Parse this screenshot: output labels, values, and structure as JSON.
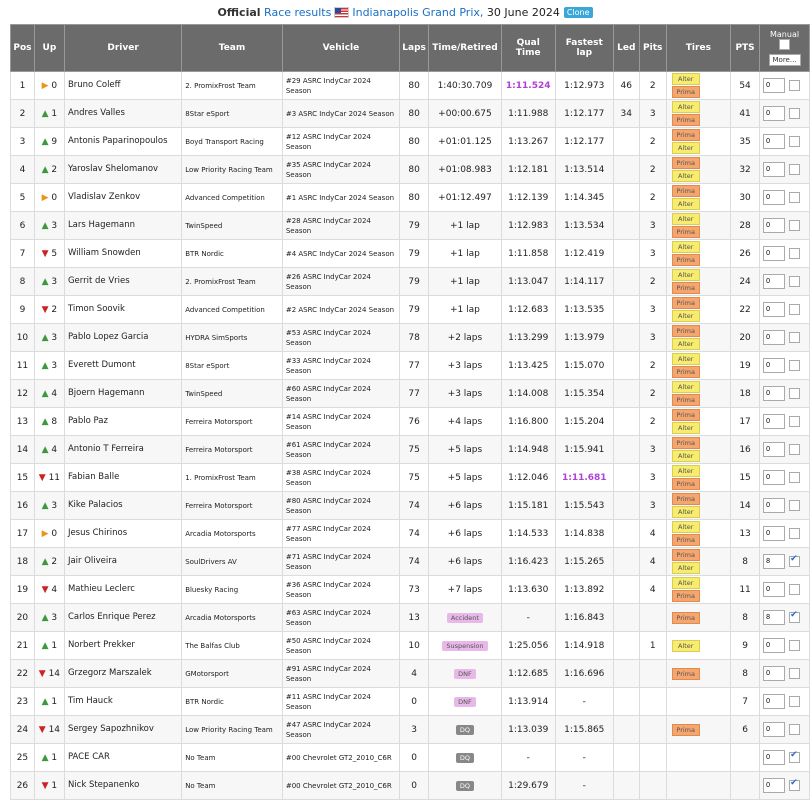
{
  "header": {
    "prefix": "Official",
    "link": "Race results",
    "event": "Indianapolis Grand Prix,",
    "date": "30 June 2024",
    "clone_label": "Clone"
  },
  "columns": [
    "Pos",
    "Up",
    "Driver",
    "Team",
    "Vehicle",
    "Laps",
    "Time/Retired",
    "Qual Time",
    "Fastest lap",
    "Led",
    "Pits",
    "Tires",
    "PTS"
  ],
  "manual": {
    "label": "Manual",
    "more_label": "More..."
  },
  "rows": [
    {
      "pos": "1",
      "up": "0",
      "dir": "same",
      "driver": "Bruno Coleff",
      "team": "2. PromixFrost Team",
      "vehicle": "#29 ASRC IndyCar 2024 Season",
      "laps": "80",
      "time": "1:40:30.709",
      "qual": "1:11.524",
      "qual_best": true,
      "fast": "1:12.973",
      "fast_best": false,
      "led": "46",
      "pits": "2",
      "tires": [
        "Alter",
        "Prima"
      ],
      "pts": "54",
      "manual": "0",
      "checked": false
    },
    {
      "pos": "2",
      "up": "1",
      "dir": "up",
      "driver": "Andres Valles",
      "team": "8Star eSport",
      "vehicle": "#3 ASRC IndyCar 2024 Season",
      "laps": "80",
      "time": "+00:00.675",
      "qual": "1:11.988",
      "qual_best": false,
      "fast": "1:12.177",
      "fast_best": false,
      "led": "34",
      "pits": "3",
      "tires": [
        "Alter",
        "Prima"
      ],
      "pts": "41",
      "manual": "0",
      "checked": false
    },
    {
      "pos": "3",
      "up": "9",
      "dir": "up",
      "driver": "Antonis Paparinopoulos",
      "team": "Boyd Transport Racing",
      "vehicle": "#12 ASRC IndyCar 2024 Season",
      "laps": "80",
      "time": "+01:01.125",
      "qual": "1:13.267",
      "qual_best": false,
      "fast": "1:12.177",
      "fast_best": false,
      "led": "",
      "pits": "2",
      "tires": [
        "Prima",
        "Alter"
      ],
      "pts": "35",
      "manual": "0",
      "checked": false
    },
    {
      "pos": "4",
      "up": "2",
      "dir": "up",
      "driver": "Yaroslav Shelomanov",
      "team": "Low Priority Racing Team",
      "vehicle": "#35 ASRC IndyCar 2024 Season",
      "laps": "80",
      "time": "+01:08.983",
      "qual": "1:12.181",
      "qual_best": false,
      "fast": "1:13.514",
      "fast_best": false,
      "led": "",
      "pits": "2",
      "tires": [
        "Prima",
        "Alter"
      ],
      "pts": "32",
      "manual": "0",
      "checked": false
    },
    {
      "pos": "5",
      "up": "0",
      "dir": "same",
      "driver": "Vladislav Zenkov",
      "team": "Advanced Competition",
      "vehicle": "#1 ASRC IndyCar 2024 Season",
      "laps": "80",
      "time": "+01:12.497",
      "qual": "1:12.139",
      "qual_best": false,
      "fast": "1:14.345",
      "fast_best": false,
      "led": "",
      "pits": "2",
      "tires": [
        "Prima",
        "Alter"
      ],
      "pts": "30",
      "manual": "0",
      "checked": false
    },
    {
      "pos": "6",
      "up": "3",
      "dir": "up",
      "driver": "Lars Hagemann",
      "team": "TwinSpeed",
      "vehicle": "#28 ASRC IndyCar 2024 Season",
      "laps": "79",
      "time": "+1 lap",
      "qual": "1:12.983",
      "qual_best": false,
      "fast": "1:13.534",
      "fast_best": false,
      "led": "",
      "pits": "3",
      "tires": [
        "Alter",
        "Prima"
      ],
      "pts": "28",
      "manual": "0",
      "checked": false
    },
    {
      "pos": "7",
      "up": "5",
      "dir": "down",
      "driver": "William Snowden",
      "team": "BTR Nordic",
      "vehicle": "#4 ASRC IndyCar 2024 Season",
      "laps": "79",
      "time": "+1 lap",
      "qual": "1:11.858",
      "qual_best": false,
      "fast": "1:12.419",
      "fast_best": false,
      "led": "",
      "pits": "3",
      "tires": [
        "Alter",
        "Prima"
      ],
      "pts": "26",
      "manual": "0",
      "checked": false
    },
    {
      "pos": "8",
      "up": "3",
      "dir": "up",
      "driver": "Gerrit de Vries",
      "team": "2. PromixFrost Team",
      "vehicle": "#26 ASRC IndyCar 2024 Season",
      "laps": "79",
      "time": "+1 lap",
      "qual": "1:13.047",
      "qual_best": false,
      "fast": "1:14.117",
      "fast_best": false,
      "led": "",
      "pits": "2",
      "tires": [
        "Alter",
        "Prima"
      ],
      "pts": "24",
      "manual": "0",
      "checked": false
    },
    {
      "pos": "9",
      "up": "2",
      "dir": "down",
      "driver": "Timon Soovik",
      "team": "Advanced Competition",
      "vehicle": "#2 ASRC IndyCar 2024 Season",
      "laps": "79",
      "time": "+1 lap",
      "qual": "1:12.683",
      "qual_best": false,
      "fast": "1:13.535",
      "fast_best": false,
      "led": "",
      "pits": "3",
      "tires": [
        "Prima",
        "Alter"
      ],
      "pts": "22",
      "manual": "0",
      "checked": false
    },
    {
      "pos": "10",
      "up": "3",
      "dir": "up",
      "driver": "Pablo Lopez Garcia",
      "team": "HYDRA SimSports",
      "vehicle": "#53 ASRC IndyCar 2024 Season",
      "laps": "78",
      "time": "+2 laps",
      "qual": "1:13.299",
      "qual_best": false,
      "fast": "1:13.979",
      "fast_best": false,
      "led": "",
      "pits": "3",
      "tires": [
        "Prima",
        "Alter"
      ],
      "pts": "20",
      "manual": "0",
      "checked": false
    },
    {
      "pos": "11",
      "up": "3",
      "dir": "up",
      "driver": "Everett Dumont",
      "team": "8Star eSport",
      "vehicle": "#33 ASRC IndyCar 2024 Season",
      "laps": "77",
      "time": "+3 laps",
      "qual": "1:13.425",
      "qual_best": false,
      "fast": "1:15.070",
      "fast_best": false,
      "led": "",
      "pits": "2",
      "tires": [
        "Alter",
        "Prima"
      ],
      "pts": "19",
      "manual": "0",
      "checked": false
    },
    {
      "pos": "12",
      "up": "4",
      "dir": "up",
      "driver": "Bjoern Hagemann",
      "team": "TwinSpeed",
      "vehicle": "#60 ASRC IndyCar 2024 Season",
      "laps": "77",
      "time": "+3 laps",
      "qual": "1:14.008",
      "qual_best": false,
      "fast": "1:15.354",
      "fast_best": false,
      "led": "",
      "pits": "2",
      "tires": [
        "Alter",
        "Prima"
      ],
      "pts": "18",
      "manual": "0",
      "checked": false
    },
    {
      "pos": "13",
      "up": "8",
      "dir": "up",
      "driver": "Pablo Paz",
      "team": "Ferreira Motorsport",
      "vehicle": "#14 ASRC IndyCar 2024 Season",
      "laps": "76",
      "time": "+4 laps",
      "qual": "1:16.800",
      "qual_best": false,
      "fast": "1:15.204",
      "fast_best": false,
      "led": "",
      "pits": "2",
      "tires": [
        "Prima",
        "Alter"
      ],
      "pts": "17",
      "manual": "0",
      "checked": false
    },
    {
      "pos": "14",
      "up": "4",
      "dir": "up",
      "driver": "Antonio T Ferreira",
      "team": "Ferreira Motorsport",
      "vehicle": "#61 ASRC IndyCar 2024 Season",
      "laps": "75",
      "time": "+5 laps",
      "qual": "1:14.948",
      "qual_best": false,
      "fast": "1:15.941",
      "fast_best": false,
      "led": "",
      "pits": "3",
      "tires": [
        "Prima",
        "Alter"
      ],
      "pts": "16",
      "manual": "0",
      "checked": false
    },
    {
      "pos": "15",
      "up": "11",
      "dir": "down",
      "driver": "Fabian Balle",
      "team": "1. PromixFrost Team",
      "vehicle": "#38 ASRC IndyCar 2024 Season",
      "laps": "75",
      "time": "+5 laps",
      "qual": "1:12.046",
      "qual_best": false,
      "fast": "1:11.681",
      "fast_best": true,
      "led": "",
      "pits": "3",
      "tires": [
        "Alter",
        "Prima"
      ],
      "pts": "15",
      "manual": "0",
      "checked": false
    },
    {
      "pos": "16",
      "up": "3",
      "dir": "up",
      "driver": "Kike Palacios",
      "team": "Ferreira Motorsport",
      "vehicle": "#80 ASRC IndyCar 2024 Season",
      "laps": "74",
      "time": "+6 laps",
      "qual": "1:15.181",
      "qual_best": false,
      "fast": "1:15.543",
      "fast_best": false,
      "led": "",
      "pits": "3",
      "tires": [
        "Prima",
        "Alter"
      ],
      "pts": "14",
      "manual": "0",
      "checked": false
    },
    {
      "pos": "17",
      "up": "0",
      "dir": "same",
      "driver": "Jesus Chirinos",
      "team": "Arcadia Motorsports",
      "vehicle": "#77 ASRC IndyCar 2024 Season",
      "laps": "74",
      "time": "+6 laps",
      "qual": "1:14.533",
      "qual_best": false,
      "fast": "1:14.838",
      "fast_best": false,
      "led": "",
      "pits": "4",
      "tires": [
        "Alter",
        "Prima"
      ],
      "pts": "13",
      "manual": "0",
      "checked": false
    },
    {
      "pos": "18",
      "up": "2",
      "dir": "up",
      "driver": "Jair Oliveira",
      "team": "SoulDrivers AV",
      "vehicle": "#71 ASRC IndyCar 2024 Season",
      "laps": "74",
      "time": "+6 laps",
      "qual": "1:16.423",
      "qual_best": false,
      "fast": "1:15.265",
      "fast_best": false,
      "led": "",
      "pits": "4",
      "tires": [
        "Prima",
        "Alter"
      ],
      "pts": "8",
      "manual": "8",
      "checked": true
    },
    {
      "pos": "19",
      "up": "4",
      "dir": "down",
      "driver": "Mathieu Leclerc",
      "team": "Bluesky Racing",
      "vehicle": "#36 ASRC IndyCar 2024 Season",
      "laps": "73",
      "time": "+7 laps",
      "qual": "1:13.630",
      "qual_best": false,
      "fast": "1:13.892",
      "fast_best": false,
      "led": "",
      "pits": "4",
      "tires": [
        "Alter",
        "Prima"
      ],
      "pts": "11",
      "manual": "0",
      "checked": false
    },
    {
      "pos": "20",
      "up": "3",
      "dir": "up",
      "driver": "Carlos Enrique Perez",
      "team": "Arcadia Motorsports",
      "vehicle": "#63 ASRC IndyCar 2024 Season",
      "laps": "13",
      "time": "",
      "status": "Accident",
      "qual": "-",
      "qual_best": false,
      "fast": "1:16.843",
      "fast_best": false,
      "led": "",
      "pits": "",
      "tires": [
        "Prima"
      ],
      "pts": "8",
      "manual": "8",
      "checked": true
    },
    {
      "pos": "21",
      "up": "1",
      "dir": "up",
      "driver": "Norbert Prekker",
      "team": "The Balfas Club",
      "vehicle": "#50 ASRC IndyCar 2024 Season",
      "laps": "10",
      "time": "",
      "status": "Suspension",
      "qual": "1:25.056",
      "qual_best": false,
      "fast": "1:14.918",
      "fast_best": false,
      "led": "",
      "pits": "1",
      "tires": [
        "Alter"
      ],
      "pts": "9",
      "manual": "0",
      "checked": false
    },
    {
      "pos": "22",
      "up": "14",
      "dir": "down",
      "driver": "Grzegorz Marszalek",
      "team": "GMotorsport",
      "vehicle": "#91 ASRC IndyCar 2024 Season",
      "laps": "4",
      "time": "",
      "status": "DNF",
      "qual": "1:12.685",
      "qual_best": false,
      "fast": "1:16.696",
      "fast_best": false,
      "led": "",
      "pits": "",
      "tires": [
        "Prima"
      ],
      "pts": "8",
      "manual": "0",
      "checked": false
    },
    {
      "pos": "23",
      "up": "1",
      "dir": "up",
      "driver": "Tim Hauck",
      "team": "BTR Nordic",
      "vehicle": "#11 ASRC IndyCar 2024 Season",
      "laps": "0",
      "time": "",
      "status": "DNF",
      "qual": "1:13.914",
      "qual_best": false,
      "fast": "-",
      "fast_best": false,
      "led": "",
      "pits": "",
      "tires": [],
      "pts": "7",
      "manual": "0",
      "checked": false
    },
    {
      "pos": "24",
      "up": "14",
      "dir": "down",
      "driver": "Sergey Sapozhnikov",
      "team": "Low Priority Racing Team",
      "vehicle": "#47 ASRC IndyCar 2024 Season",
      "laps": "3",
      "time": "",
      "status": "DQ",
      "qual": "1:13.039",
      "qual_best": false,
      "fast": "1:15.865",
      "fast_best": false,
      "led": "",
      "pits": "",
      "tires": [
        "Prima"
      ],
      "pts": "6",
      "manual": "0",
      "checked": false
    },
    {
      "pos": "25",
      "up": "1",
      "dir": "up",
      "driver": "PACE CAR",
      "team": "No Team",
      "vehicle": "#00 Chevrolet GT2_2010_C6R",
      "laps": "0",
      "time": "",
      "status": "DQ",
      "qual": "-",
      "qual_best": false,
      "fast": "-",
      "fast_best": false,
      "led": "",
      "pits": "",
      "tires": [],
      "pts": "",
      "manual": "0",
      "checked": true
    },
    {
      "pos": "26",
      "up": "1",
      "dir": "down",
      "driver": "Nick Stepanenko",
      "team": "No Team",
      "vehicle": "#00 Chevrolet GT2_2010_C6R",
      "laps": "0",
      "time": "",
      "status": "DQ",
      "qual": "1:29.679",
      "qual_best": false,
      "fast": "-",
      "fast_best": false,
      "led": "",
      "pits": "",
      "tires": [],
      "pts": "",
      "manual": "0",
      "checked": true
    }
  ]
}
